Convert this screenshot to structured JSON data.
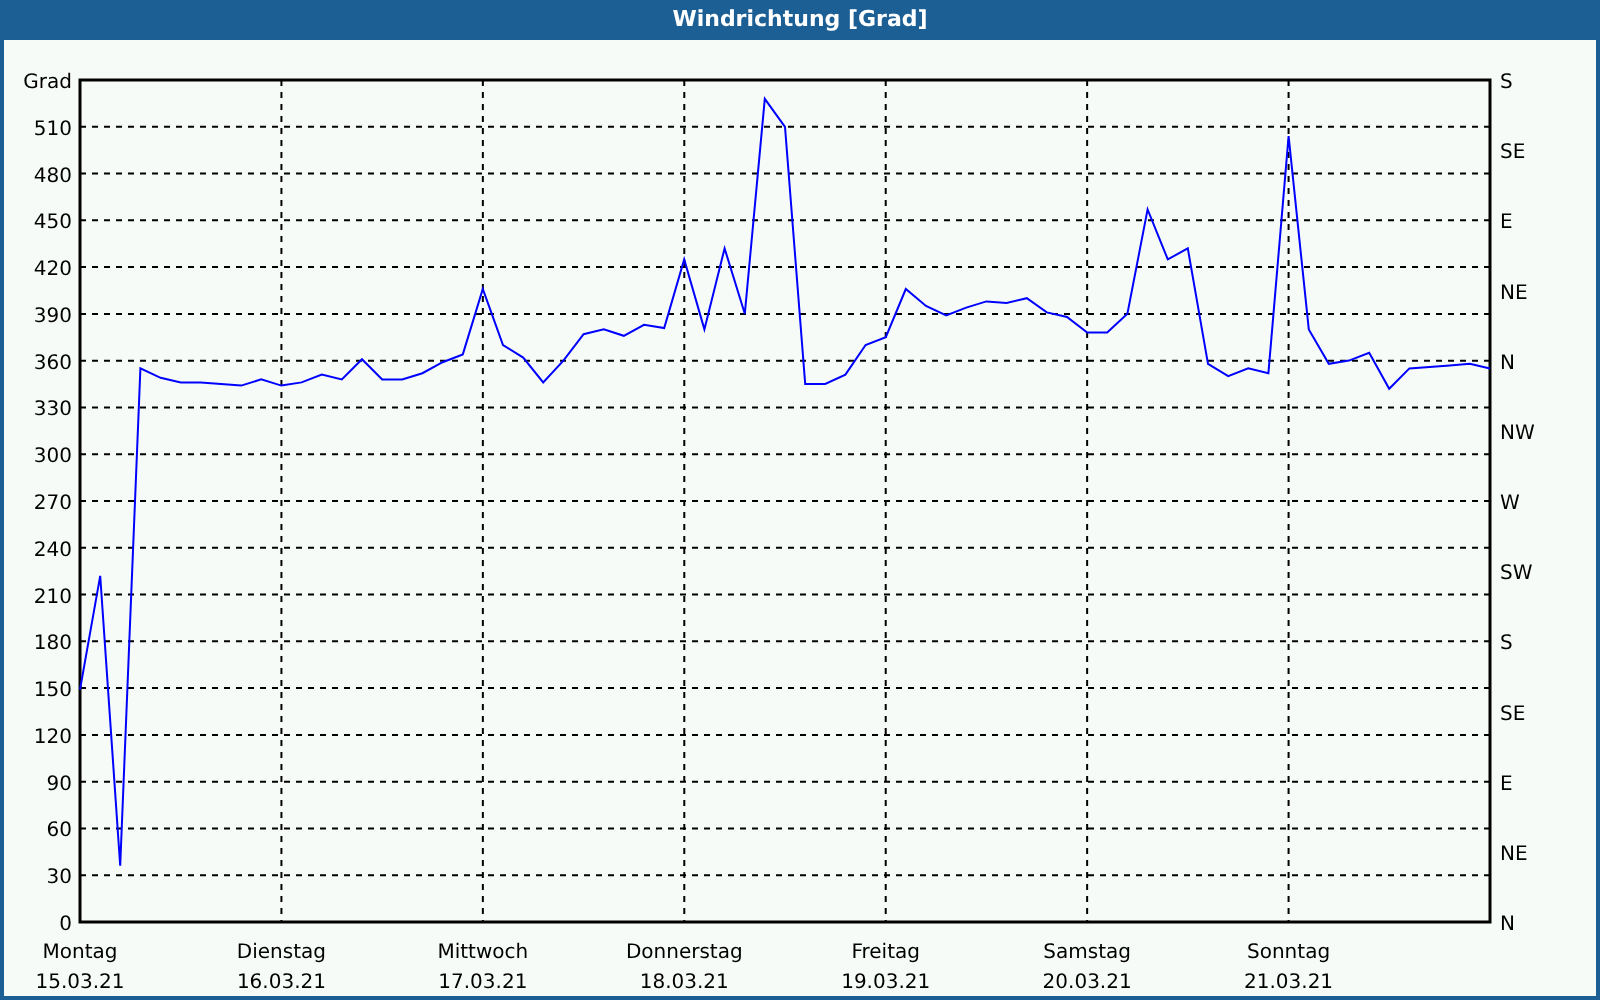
{
  "window": {
    "title": "Windrichtung [Grad]"
  },
  "chart": {
    "chart_data": {
      "type": "line",
      "grid": true,
      "ylabel": "Grad",
      "ylim": [
        0,
        540
      ],
      "yticks": [
        0,
        30,
        60,
        90,
        120,
        150,
        180,
        210,
        240,
        270,
        300,
        330,
        360,
        390,
        420,
        450,
        480,
        510
      ],
      "categories": [
        "Montag 15.03.21",
        null,
        null,
        null,
        null,
        null,
        null,
        null,
        null,
        null,
        "Dienstag 16.03.21",
        null,
        null,
        null,
        null,
        null,
        null,
        null,
        null,
        null,
        "Mittwoch 17.03.21",
        null,
        null,
        null,
        null,
        null,
        null,
        null,
        null,
        null,
        "Donnerstag 18.03.21",
        null,
        null,
        null,
        null,
        null,
        null,
        null,
        null,
        null,
        "Freitag 19.03.21",
        null,
        null,
        null,
        null,
        null,
        null,
        null,
        null,
        null,
        "Samstag 20.03.21",
        null,
        null,
        null,
        null,
        null,
        null,
        null,
        null,
        null,
        "Sonntag 21.03.21",
        null,
        null,
        null,
        null,
        null,
        null,
        null,
        null,
        null,
        null
      ],
      "series": [
        {
          "color": "#0000ff",
          "values": [
            149,
            222,
            36,
            355,
            349,
            346,
            346,
            345,
            344,
            348,
            344,
            346,
            351,
            348,
            361,
            348,
            348,
            352,
            359,
            364,
            406,
            370,
            362,
            346,
            360,
            377,
            380,
            376,
            383,
            381,
            425,
            380,
            432,
            390,
            528,
            510,
            345,
            345,
            351,
            370,
            375,
            406,
            395,
            389,
            394,
            398,
            397,
            400,
            391,
            388,
            378,
            378,
            390,
            457,
            425,
            432,
            358,
            350,
            355,
            352,
            504,
            380,
            358,
            360,
            365,
            342,
            355,
            356,
            357,
            358,
            355
          ]
        }
      ]
    },
    "right_axis_labels": [
      "S",
      "SE",
      "E",
      "NE",
      "N",
      "NW",
      "W",
      "SW",
      "S",
      "SE",
      "E",
      "NE",
      "N"
    ]
  }
}
